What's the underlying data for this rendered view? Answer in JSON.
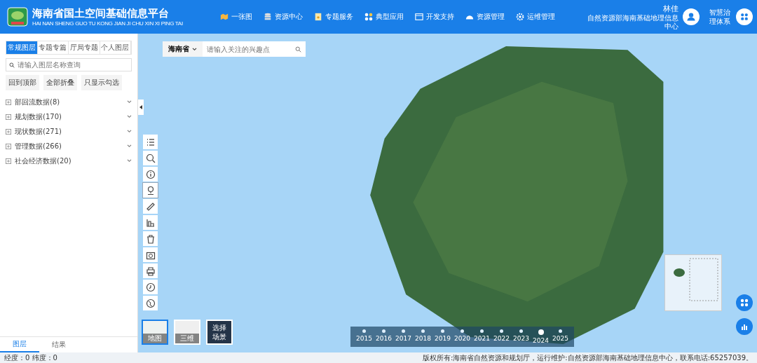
{
  "header": {
    "title": "海南省国土空间基础信息平台",
    "subtitle": "HAI NAN SHENG GUO TU KONG JIAN JI CHU XIN XI PING TAI",
    "nav": [
      "一张图",
      "资源中心",
      "专题服务",
      "典型应用",
      "开发支持",
      "资源管理",
      "运维管理"
    ],
    "user": {
      "name": "林佳",
      "org": "自然资源部海南基础地理信息中心"
    },
    "app_link": "智慧治理体系"
  },
  "sidebar": {
    "tabs": [
      {
        "label": "常规图层",
        "selected": true
      },
      {
        "label": "专题专篇",
        "selected": false
      },
      {
        "label": "厅局专题",
        "selected": false
      },
      {
        "label": "个人图层",
        "selected": false
      }
    ],
    "search": {
      "placeholder": "请输入图层名称查询"
    },
    "actions": [
      "回到顶部",
      "全部折叠",
      "只显示勾选"
    ],
    "groups": [
      {
        "label": "部回流数据(8)",
        "expanded": false
      },
      {
        "label": "规划数据(170)",
        "expanded": false
      },
      {
        "label": "现状数据(271)",
        "expanded": false
      },
      {
        "label": "管理数据(266)",
        "expanded": false
      },
      {
        "label": "社会经济数据(20)",
        "expanded": false
      }
    ],
    "bottom_tabs": [
      {
        "label": "图层",
        "selected": true
      },
      {
        "label": "结果",
        "selected": false
      }
    ]
  },
  "map": {
    "region": "海南省",
    "search": {
      "placeholder": "请输入关注的兴趣点"
    },
    "basemaps": [
      {
        "label": "地图",
        "kind": "map",
        "selected": true
      },
      {
        "label": "三维",
        "kind": "aerial",
        "selected": false
      },
      {
        "label": "选择场景",
        "kind": "scene",
        "selected": false
      }
    ],
    "years": [
      {
        "label": "2015",
        "selected": false
      },
      {
        "label": "2016",
        "selected": false
      },
      {
        "label": "2017",
        "selected": false
      },
      {
        "label": "2018",
        "selected": false
      },
      {
        "label": "2019",
        "selected": false
      },
      {
        "label": "2020",
        "selected": false
      },
      {
        "label": "2021",
        "selected": false
      },
      {
        "label": "2022",
        "selected": false
      },
      {
        "label": "2023",
        "selected": false
      },
      {
        "label": "2024",
        "selected": true
      },
      {
        "label": "2025",
        "selected": false
      }
    ]
  },
  "status_bar": {
    "coords": "经度：0 纬度：0",
    "copyright": "版权所有:海南省自然资源和规划厅，运行维护:自然资源部海南基础地理信息中心，联系电话:65257039。"
  }
}
